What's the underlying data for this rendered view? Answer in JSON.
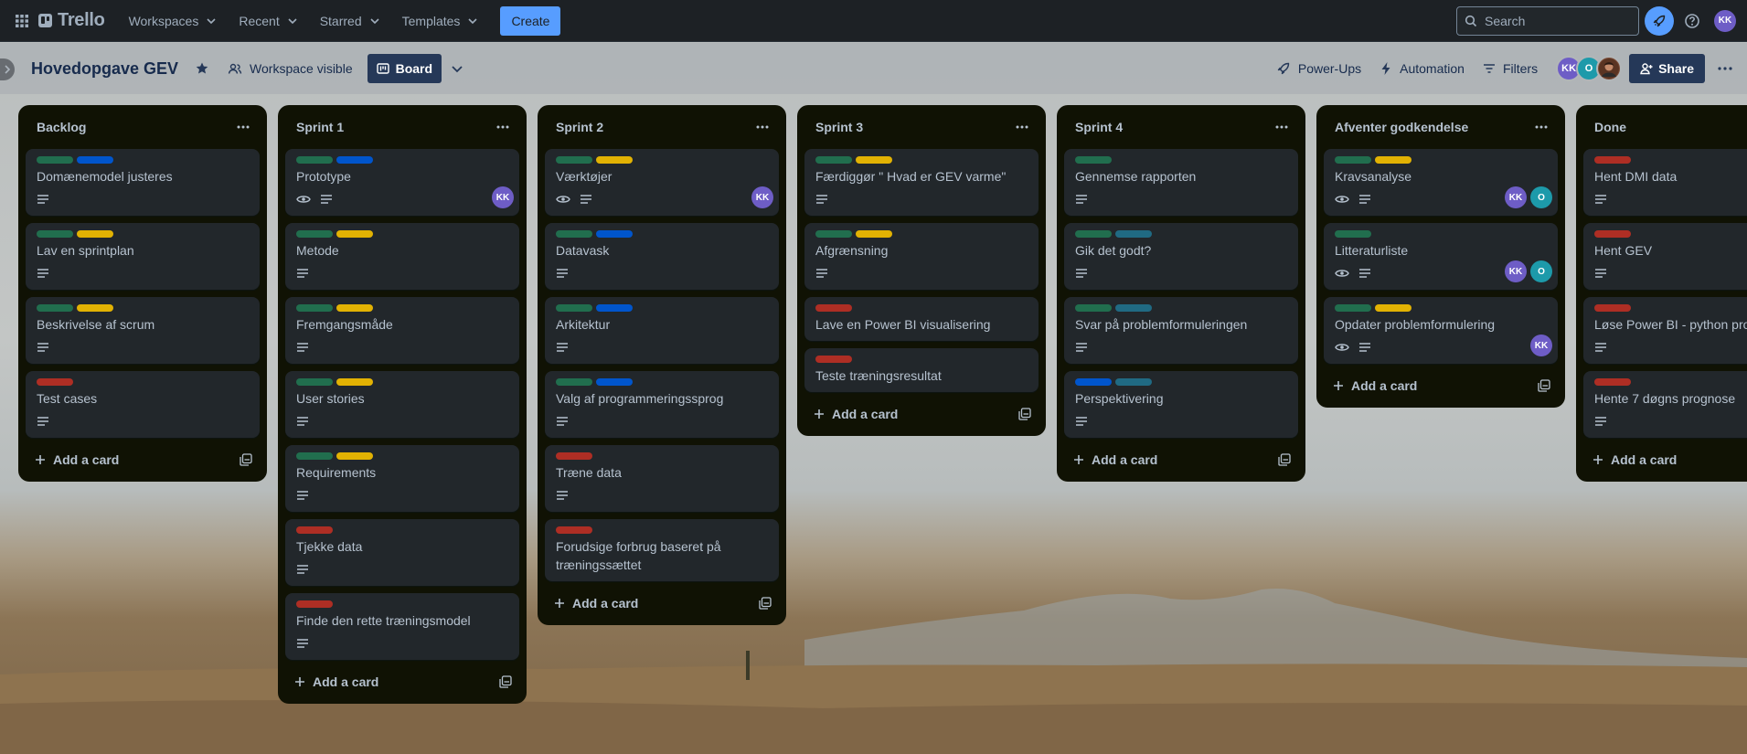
{
  "app": {
    "name": "Trello"
  },
  "nav": {
    "workspaces": "Workspaces",
    "recent": "Recent",
    "starred": "Starred",
    "templates": "Templates",
    "create": "Create",
    "search_placeholder": "Search",
    "user_initials": "KK"
  },
  "board": {
    "title": "Hovedopgave GEV",
    "visibility": "Workspace visible",
    "view": "Board",
    "power_ups": "Power-Ups",
    "automation": "Automation",
    "filters": "Filters",
    "share": "Share",
    "members": [
      {
        "initials": "KK",
        "color": "#6e5dc6"
      },
      {
        "initials": "O",
        "color": "#1d9aaa"
      },
      {
        "initials": "",
        "color": "#7a4a34"
      }
    ]
  },
  "colors": {
    "green": "#216e4e",
    "blue": "#0055cc",
    "yellow": "#e2b203",
    "red": "#ae2e24",
    "teal": "#206a83",
    "avatar_kk": "#6e5dc6",
    "avatar_o": "#1d9aaa"
  },
  "add_card_label": "Add a card",
  "lists": [
    {
      "title": "Backlog",
      "cards": [
        {
          "title": "Domænemodel justeres",
          "labels": [
            "green",
            "blue"
          ],
          "watch": false,
          "members": []
        },
        {
          "title": "Lav en sprintplan",
          "labels": [
            "green",
            "yellow"
          ],
          "watch": false,
          "members": []
        },
        {
          "title": "Beskrivelse af scrum",
          "labels": [
            "green",
            "yellow"
          ],
          "watch": false,
          "members": []
        },
        {
          "title": "Test cases",
          "labels": [
            "red"
          ],
          "watch": false,
          "members": []
        }
      ]
    },
    {
      "title": "Sprint 1",
      "cards": [
        {
          "title": "Prototype",
          "labels": [
            "green",
            "blue"
          ],
          "watch": true,
          "members": [
            "KK"
          ]
        },
        {
          "title": "Metode",
          "labels": [
            "green",
            "yellow"
          ],
          "watch": false,
          "members": []
        },
        {
          "title": "Fremgangsmåde",
          "labels": [
            "green",
            "yellow"
          ],
          "watch": false,
          "members": []
        },
        {
          "title": "User stories",
          "labels": [
            "green",
            "yellow"
          ],
          "watch": false,
          "members": []
        },
        {
          "title": "Requirements",
          "labels": [
            "green",
            "yellow"
          ],
          "watch": false,
          "members": []
        },
        {
          "title": "Tjekke data",
          "labels": [
            "red"
          ],
          "watch": false,
          "members": []
        },
        {
          "title": "Finde den rette træningsmodel",
          "labels": [
            "red"
          ],
          "watch": false,
          "members": []
        }
      ]
    },
    {
      "title": "Sprint 2",
      "cards": [
        {
          "title": "Værktøjer",
          "labels": [
            "green",
            "yellow"
          ],
          "watch": true,
          "members": [
            "KK"
          ]
        },
        {
          "title": "Datavask",
          "labels": [
            "green",
            "blue"
          ],
          "watch": false,
          "members": []
        },
        {
          "title": "Arkitektur",
          "labels": [
            "green",
            "blue"
          ],
          "watch": false,
          "members": []
        },
        {
          "title": "Valg af programmeringssprog",
          "labels": [
            "green",
            "blue"
          ],
          "watch": false,
          "members": []
        },
        {
          "title": "Træne data",
          "labels": [
            "red"
          ],
          "watch": false,
          "members": []
        },
        {
          "title": "Forudsige forbrug baseret på træningssættet",
          "labels": [
            "red"
          ],
          "watch": false,
          "members": [],
          "nodesc": true
        }
      ]
    },
    {
      "title": "Sprint 3",
      "cards": [
        {
          "title": "Færdiggør \" Hvad er GEV varme\"",
          "labels": [
            "green",
            "yellow"
          ],
          "watch": false,
          "members": []
        },
        {
          "title": "Afgrænsning",
          "labels": [
            "green",
            "yellow"
          ],
          "watch": false,
          "members": []
        },
        {
          "title": "Lave en Power BI visualisering",
          "labels": [
            "red"
          ],
          "watch": false,
          "members": [],
          "nodesc": true
        },
        {
          "title": "Teste træningsresultat",
          "labels": [
            "red"
          ],
          "watch": false,
          "members": [],
          "nodesc": true
        }
      ]
    },
    {
      "title": "Sprint 4",
      "cards": [
        {
          "title": "Gennemse rapporten",
          "labels": [
            "green"
          ],
          "watch": false,
          "members": []
        },
        {
          "title": "Gik det godt?",
          "labels": [
            "green",
            "teal"
          ],
          "watch": false,
          "members": []
        },
        {
          "title": "Svar på problemformuleringen",
          "labels": [
            "green",
            "teal"
          ],
          "watch": false,
          "members": []
        },
        {
          "title": "Perspektivering",
          "labels": [
            "blue",
            "teal"
          ],
          "watch": false,
          "members": []
        }
      ]
    },
    {
      "title": "Afventer godkendelse",
      "cards": [
        {
          "title": "Kravsanalyse",
          "labels": [
            "green",
            "yellow"
          ],
          "watch": true,
          "members": [
            "KK",
            "O"
          ]
        },
        {
          "title": "Litteraturliste",
          "labels": [
            "green"
          ],
          "watch": true,
          "members": [
            "KK",
            "O"
          ]
        },
        {
          "title": "Opdater problemformulering",
          "labels": [
            "green",
            "yellow"
          ],
          "watch": true,
          "members": [
            "KK"
          ]
        }
      ]
    },
    {
      "title": "Done",
      "cards": [
        {
          "title": "Hent DMI data",
          "labels": [
            "red"
          ],
          "watch": false,
          "members": []
        },
        {
          "title": "Hent GEV",
          "labels": [
            "red"
          ],
          "watch": false,
          "members": []
        },
        {
          "title": "Løse Power BI - python problem",
          "labels": [
            "red"
          ],
          "watch": false,
          "members": []
        },
        {
          "title": "Hente 7 døgns prognose",
          "labels": [
            "red"
          ],
          "watch": false,
          "members": []
        }
      ]
    }
  ]
}
